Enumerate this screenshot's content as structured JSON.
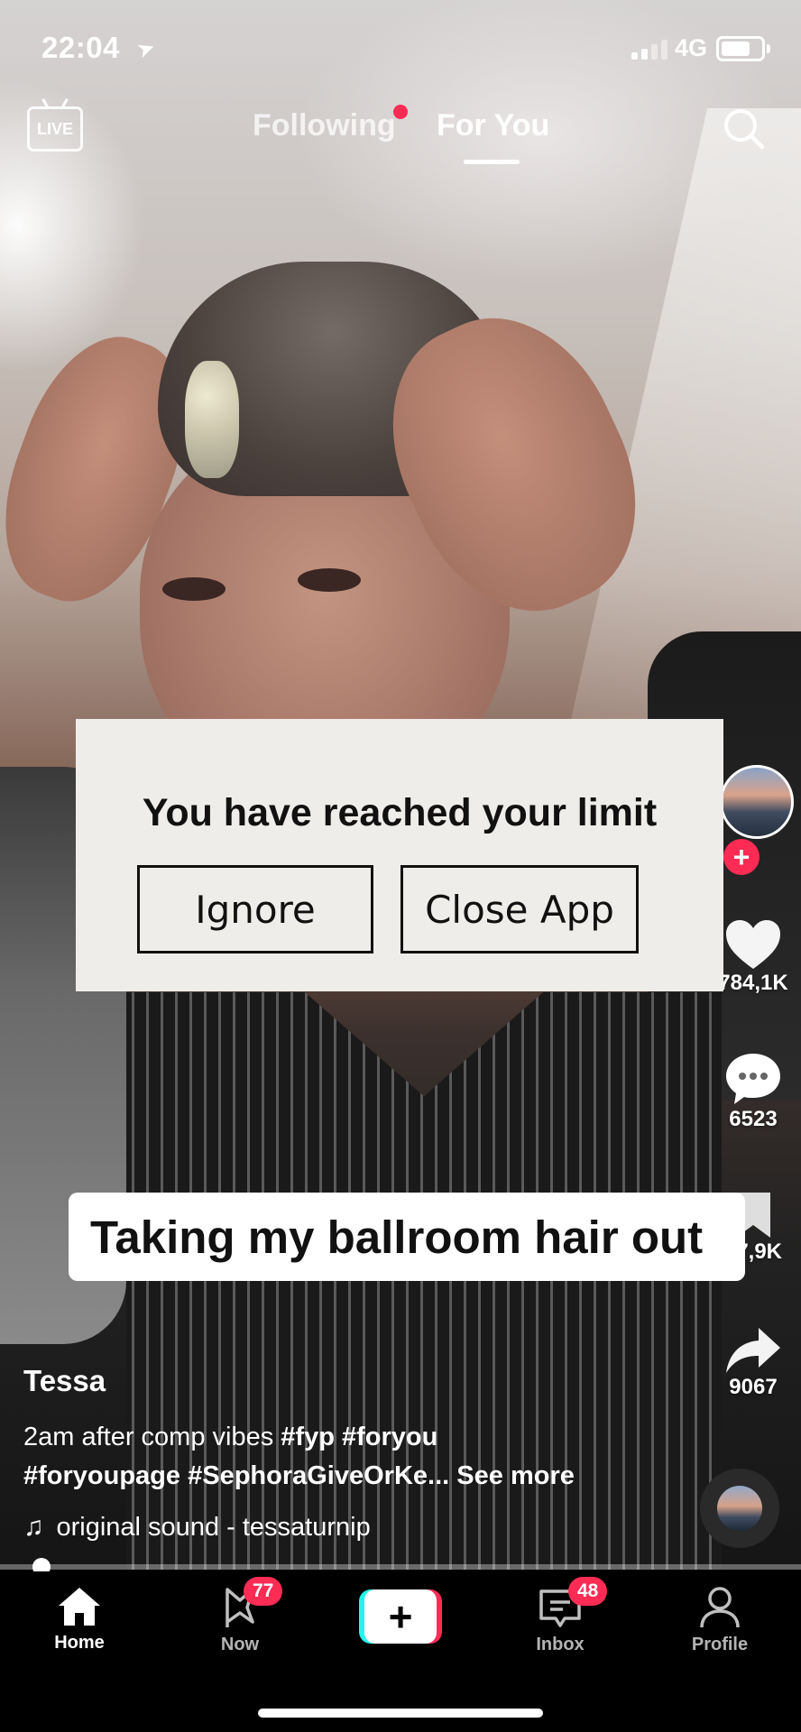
{
  "status_bar": {
    "time": "22:04",
    "network": "4G",
    "battery_level": 0.85
  },
  "top_nav": {
    "live_label": "LIVE",
    "tabs": [
      {
        "label": "Following",
        "has_dot": true,
        "active": false
      },
      {
        "label": "For You",
        "active": true
      }
    ]
  },
  "modal": {
    "title": "You have reached your limit",
    "ignore_label": "Ignore",
    "close_label": "Close App"
  },
  "video": {
    "caption_sticker": "Taking my ballroom hair out",
    "username": "Tessa",
    "description_text": "2am after comp vibes",
    "hashtags": [
      "#fyp",
      "#foryou",
      "#foryoupage",
      "#SephoraGiveOrKe..."
    ],
    "see_more": "See more",
    "sound": "original sound - tessaturnip",
    "progress": 0.04
  },
  "actions": {
    "likes": "784,1K",
    "comments": "6523",
    "saves": "27,9K",
    "shares": "9067"
  },
  "bottom_nav": {
    "items": [
      {
        "label": "Home",
        "active": true
      },
      {
        "label": "Now",
        "badge": "77"
      },
      {
        "label": "Create"
      },
      {
        "label": "Inbox",
        "badge": "48"
      },
      {
        "label": "Profile"
      }
    ]
  },
  "colors": {
    "accent": "#fe2c55",
    "cyan": "#25f4ee",
    "modal_bg": "#efede9"
  }
}
